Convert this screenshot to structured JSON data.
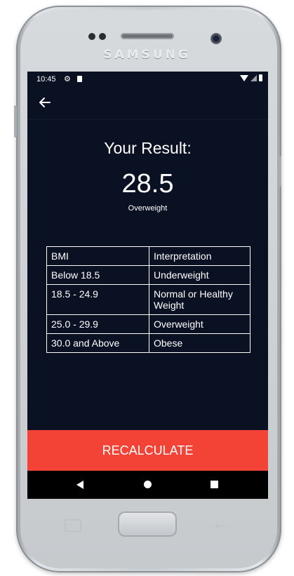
{
  "device": {
    "brand": "SAMSUNG"
  },
  "status_bar": {
    "time": "10:45",
    "icons": [
      "gear-icon",
      "sd-card-icon",
      "wifi-icon",
      "signal-icon",
      "battery-icon"
    ]
  },
  "toolbar": {
    "back_icon": "arrow-left-icon"
  },
  "result": {
    "title": "Your Result:",
    "value": "28.5",
    "label": "Overweight"
  },
  "table": {
    "headers": [
      "BMI",
      "Interpretation"
    ],
    "rows": [
      [
        "Below 18.5",
        "Underweight"
      ],
      [
        "18.5 - 24.9",
        "Normal or Healthy Weight"
      ],
      [
        "25.0 - 29.9",
        "Overweight"
      ],
      [
        "30.0 and Above",
        "Obese"
      ]
    ]
  },
  "recalculate_label": "RECALCULATE",
  "colors": {
    "screen_bg": "#0a1123",
    "accent": "#f34336",
    "nav_bar": "#000000"
  },
  "nav_bar": {
    "icons": [
      "nav-back-icon",
      "nav-home-icon",
      "nav-recents-icon"
    ]
  }
}
